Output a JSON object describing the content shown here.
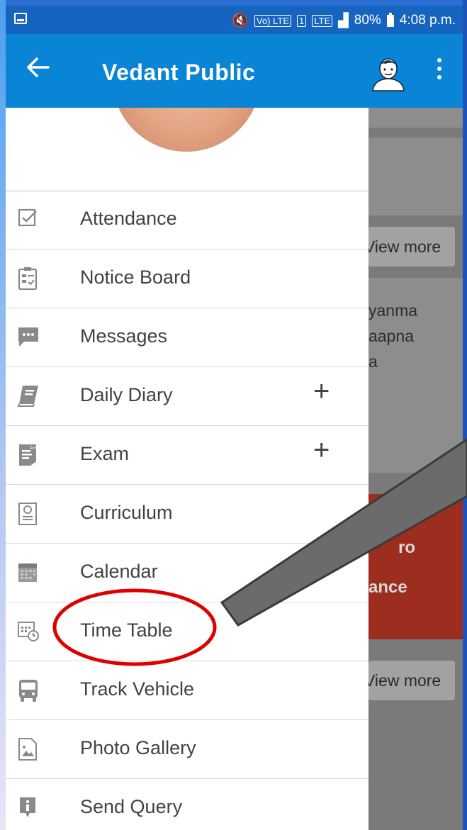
{
  "status_bar": {
    "network_label": "LTE",
    "volte_label": "Vo) LTE",
    "sim_label": "1",
    "battery_percent": "80%",
    "time": "4:08 p.m."
  },
  "app_bar": {
    "title": "Vedant Public",
    "back_icon": "arrow-left-icon",
    "profile_icon": "user-avatar-icon",
    "more_icon": "more-vert-icon"
  },
  "drawer": {
    "menu": [
      {
        "label": "Attendance",
        "icon": "checkbox-icon",
        "expandable": false
      },
      {
        "label": "Notice Board",
        "icon": "notice-board-icon",
        "expandable": false
      },
      {
        "label": "Messages",
        "icon": "chat-bubble-icon",
        "expandable": false
      },
      {
        "label": "Daily Diary",
        "icon": "book-icon",
        "expandable": true
      },
      {
        "label": "Exam",
        "icon": "exam-sheet-icon",
        "expandable": true
      },
      {
        "label": "Curriculum",
        "icon": "curriculum-icon",
        "expandable": false
      },
      {
        "label": "Calendar",
        "icon": "calendar-icon",
        "expandable": false
      },
      {
        "label": "Time Table",
        "icon": "timetable-clock-icon",
        "expandable": false
      },
      {
        "label": "Track Vehicle",
        "icon": "bus-icon",
        "expandable": false
      },
      {
        "label": "Photo Gallery",
        "icon": "photo-file-icon",
        "expandable": false
      },
      {
        "label": "Send Query",
        "icon": "info-bubble-icon",
        "expandable": false
      }
    ],
    "plus_symbol": "+"
  },
  "background_page": {
    "view_more_1": "View more",
    "snippet_line1": "yanma",
    "snippet_line2": "aapna",
    "snippet_line3": "a",
    "red_card_line1": "ro",
    "red_card_line2": "ance",
    "view_more_2": "View more"
  },
  "annotation": {
    "highlight_color": "#e00000",
    "pointer_color": "#6b6b6b"
  }
}
